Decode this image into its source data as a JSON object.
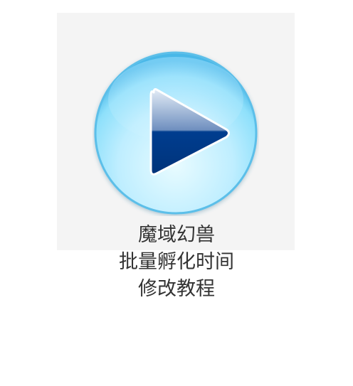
{
  "video_thumbnail": {
    "play_icon": "play-icon",
    "colors": {
      "panel_background": "#f4f4f4",
      "orb_light": "#e8fbff",
      "orb_mid": "#8ee0fb",
      "orb_edge": "#4ab8e8",
      "triangle_top": "#c9d8ec",
      "triangle_bottom": "#003d8f",
      "caption_text": "#333333"
    }
  },
  "caption": {
    "line1": "魔域幻兽",
    "line2": "批量孵化时间",
    "line3": "修改教程"
  }
}
